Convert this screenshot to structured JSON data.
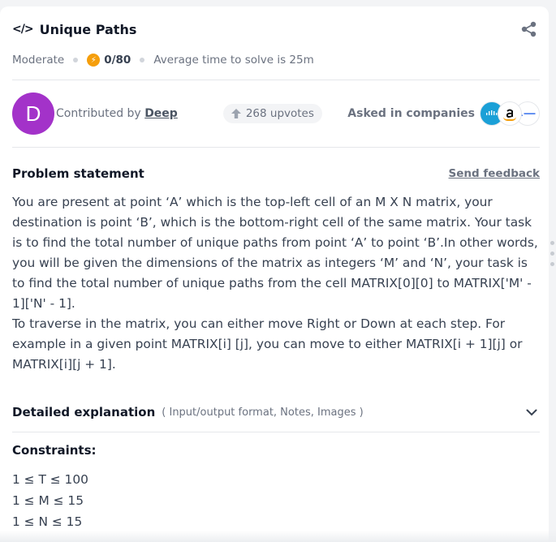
{
  "problem": {
    "title": "Unique Paths",
    "difficulty": "Moderate",
    "score": "0/80",
    "avg_time": "Average time to solve is 25m"
  },
  "contributor": {
    "avatar_letter": "D",
    "avatar_color": "#a332c9",
    "prefix": "Contributed by",
    "name": "Deep"
  },
  "upvotes": "268 upvotes",
  "asked": {
    "label": "Asked in companies",
    "companies": [
      "cisco-logo",
      "amazon-logo",
      "atlassian-logo"
    ]
  },
  "statement": {
    "heading": "Problem statement",
    "feedback": "Send feedback",
    "paragraph1": "You are present at point ‘A’ which is the top-left cell of an M X N matrix, your destination is point ‘B’, which is the bottom-right cell of the same matrix. Your task is to find the total number of unique paths from point ‘A’ to point ‘B’.In other words, you will be given the dimensions of the matrix as integers ‘M’ and ‘N’, your task is to find the total number of unique paths from the cell MATRIX[0][0] to MATRIX['M' - 1]['N' - 1].",
    "paragraph2": "To traverse in the matrix, you can either move Right or Down at each step. For example in a given point MATRIX[i] [j], you can move to either MATRIX[i + 1][j] or MATRIX[i][j + 1]."
  },
  "details": {
    "title": "Detailed explanation",
    "subtitle": "( Input/output format, Notes, Images )"
  },
  "constraints": {
    "title": "Constraints:",
    "items": [
      "1 ≤ T ≤ 100",
      "1 ≤ M ≤ 15",
      "1 ≤ N ≤ 15"
    ]
  },
  "colors": {
    "accent_bolt": "#f59e0b",
    "text": "#374151"
  }
}
